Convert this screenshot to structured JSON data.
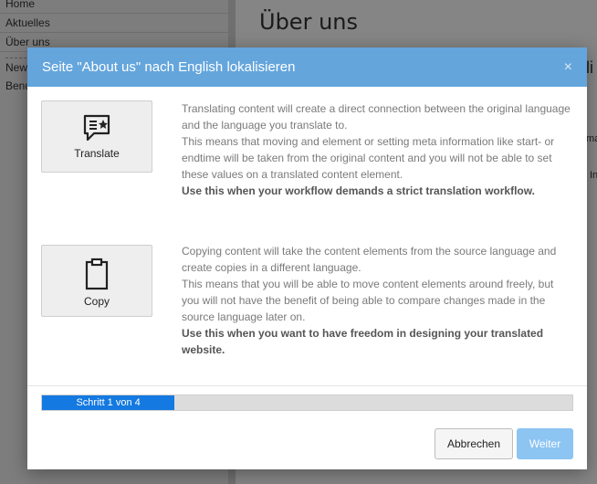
{
  "background": {
    "sidebar_items": [
      "Home",
      "Aktuelles",
      "Über uns",
      "New",
      "Benu"
    ],
    "page_title": "Über uns",
    "fragments": [
      "li",
      "ma",
      "In"
    ]
  },
  "modal": {
    "title": "Seite \"About us\" nach English lokalisieren",
    "close_icon": "×",
    "options": [
      {
        "label": "Translate",
        "icon": "translate-comment-star-icon",
        "paragraphs": [
          "Translating content will create a direct connection between the original language and the language you translate to.",
          "This means that moving and element or setting meta information like start- or endtime will be taken from the original content and you will not be able to set these values on a translated content element."
        ],
        "emphasis": "Use this when your workflow demands a strict translation workflow."
      },
      {
        "label": "Copy",
        "icon": "clipboard-icon",
        "paragraphs": [
          "Copying content will take the content elements from the source language and create copies in a different language.",
          "This means that you will be able to move content elements around freely, but you will not have the benefit of being able to compare changes made in the source language later on."
        ],
        "emphasis": "Use this when you want to have freedom in designing your translated website."
      }
    ],
    "progress": {
      "label": "Schritt 1 von 4",
      "percent": 25
    },
    "buttons": {
      "cancel": "Abbrechen",
      "next": "Weiter"
    }
  },
  "colors": {
    "header": "#64a5dc",
    "progress_fill": "#1479e0",
    "next_button": "#8cc4f2"
  }
}
